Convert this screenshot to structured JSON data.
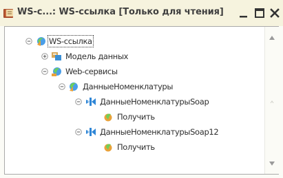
{
  "window": {
    "title": "WS-с...: WS-ссылка [Только для чтения]",
    "title_icon": "book-icon",
    "controls": [
      "minimize-icon",
      "maximize-icon",
      "close-icon"
    ]
  },
  "tree": {
    "root": {
      "label": "WS-ссылка",
      "icon": "web-service-link-icon",
      "expanded": true,
      "selected": true
    },
    "model": {
      "label": "Модель данных",
      "icon": "data-model-icon",
      "expanded": false
    },
    "services": {
      "label": "Web-сервисы",
      "icon": "web-services-icon",
      "expanded": true
    },
    "service": {
      "label": "ДанныеНоменклатуры",
      "icon": "web-service-icon",
      "expanded": true
    },
    "endpoint1": {
      "label": "ДанныеНоменклатурыSoap",
      "icon": "endpoint-icon",
      "expanded": true
    },
    "operation1": {
      "label": "Получить",
      "icon": "operation-icon"
    },
    "endpoint2": {
      "label": "ДанныеНоменклатурыSoap12",
      "icon": "endpoint-icon",
      "expanded": true
    },
    "operation2": {
      "label": "Получить",
      "icon": "operation-icon"
    }
  },
  "colors": {
    "title_bar": "#f6f3de",
    "accent_blue": "#3a8fd6",
    "border": "#a9a9a9"
  }
}
